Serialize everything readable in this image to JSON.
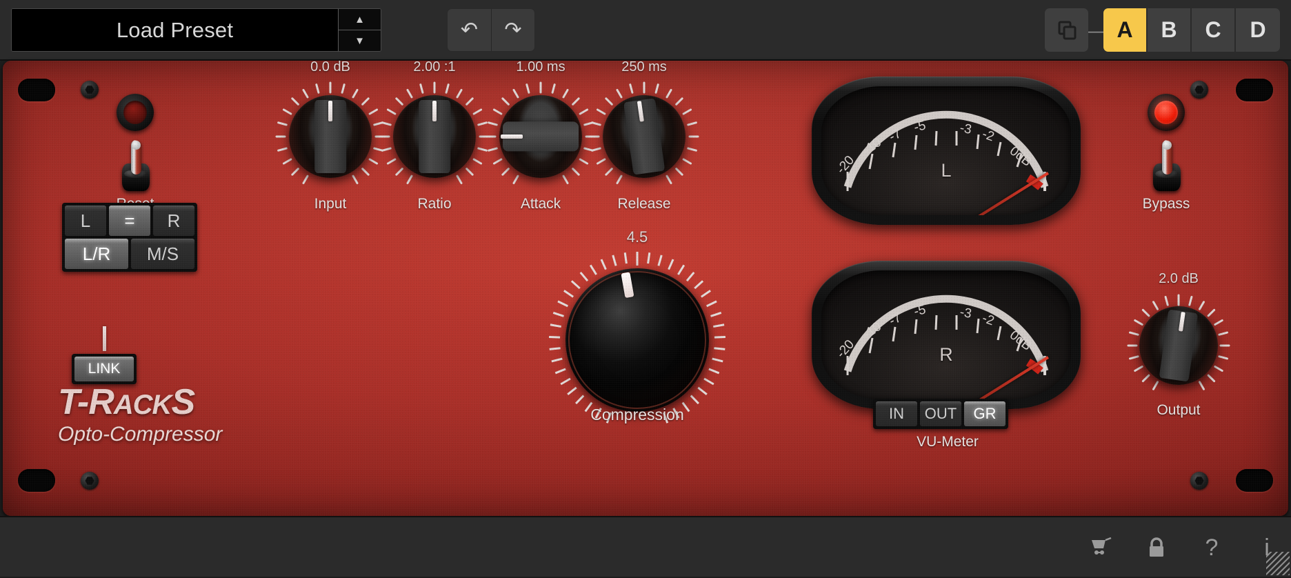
{
  "toolbar": {
    "preset_value": "Load Preset",
    "preset_placeholder": "Load Preset",
    "stepper_up": "▲",
    "stepper_down": "▼",
    "undo_label": "↶",
    "redo_label": "↷",
    "copy_icon": "copy-icon",
    "separator": "—",
    "ab_buttons": [
      {
        "label": "A",
        "active": true
      },
      {
        "label": "B",
        "active": false
      },
      {
        "label": "C",
        "active": false
      },
      {
        "label": "D",
        "active": false
      }
    ],
    "accent_color": "#f7c84b"
  },
  "plugin": {
    "brand_main": "T-R",
    "brand_main_small": "ACK",
    "brand_main_tail": "S",
    "brand_sub": "Opto-Compressor",
    "faceplate_color": "#a92f28"
  },
  "left_panel": {
    "reset_label": "Reset",
    "reset_led_on": false,
    "matrix_row1": [
      {
        "label": "L",
        "active": false
      },
      {
        "label": "=",
        "active": true
      },
      {
        "label": "R",
        "active": false
      }
    ],
    "matrix_row2": [
      {
        "label": "L/R",
        "active": true
      },
      {
        "label": "M/S",
        "active": false
      }
    ],
    "link_label": "LINK",
    "link_active": true
  },
  "knobs": [
    {
      "name": "input",
      "label": "Input",
      "value": "0.0 dB",
      "angle": 0
    },
    {
      "name": "ratio",
      "label": "Ratio",
      "value": "2.00 :1",
      "angle": 0
    },
    {
      "name": "attack",
      "label": "Attack",
      "value": "1.00 ms",
      "angle": -90
    },
    {
      "name": "release",
      "label": "Release",
      "value": "250 ms",
      "angle": -8
    }
  ],
  "compression": {
    "label": "Compression",
    "value": "4.5",
    "angle": -10
  },
  "output": {
    "label": "Output",
    "value": "2.0 dB",
    "angle": 8
  },
  "bypass": {
    "label": "Bypass",
    "led_on": true
  },
  "vu_meters": [
    {
      "channel": "L",
      "needle_angle": 58
    },
    {
      "channel": "R",
      "needle_angle": 58
    }
  ],
  "vu_scale": [
    "-20",
    "-10",
    "-7",
    "-5",
    "-3",
    "-2",
    "0dB"
  ],
  "vu_select": {
    "label": "VU-Meter",
    "buttons": [
      {
        "label": "IN",
        "active": false
      },
      {
        "label": "OUT",
        "active": false
      },
      {
        "label": "GR",
        "active": true
      }
    ]
  },
  "statusbar": {
    "icons": [
      "cart-icon",
      "lock-icon",
      "help-icon",
      "info-icon"
    ],
    "help_label": "?",
    "info_label": "i"
  }
}
